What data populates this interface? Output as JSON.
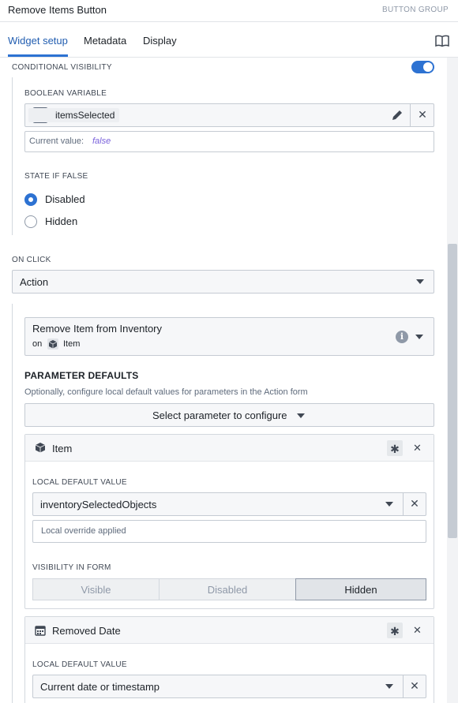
{
  "header": {
    "title": "Remove Items Button",
    "group": "BUTTON GROUP"
  },
  "tabs": [
    {
      "label": "Widget setup",
      "active": true
    },
    {
      "label": "Metadata",
      "active": false
    },
    {
      "label": "Display",
      "active": false
    }
  ],
  "conditional_visibility": {
    "label": "CONDITIONAL VISIBILITY",
    "enabled": true,
    "boolean_variable_label": "BOOLEAN VARIABLE",
    "variable_name": "itemsSelected",
    "current_value_label": "Current value:",
    "current_value": "false",
    "state_if_false_label": "STATE IF FALSE",
    "options": [
      {
        "label": "Disabled",
        "checked": true
      },
      {
        "label": "Hidden",
        "checked": false
      }
    ]
  },
  "on_click": {
    "label": "ON CLICK",
    "value": "Action"
  },
  "action": {
    "name": "Remove Item from Inventory",
    "on_label": "on",
    "object_type": "Item"
  },
  "parameter_defaults": {
    "title": "PARAMETER DEFAULTS",
    "description": "Optionally, configure local default values for parameters in the Action form",
    "select_button": "Select parameter to configure"
  },
  "params": [
    {
      "name": "Item",
      "icon": "cube-icon",
      "local_default_label": "LOCAL DEFAULT VALUE",
      "value": "inventorySelectedObjects",
      "note": "Local override applied",
      "visibility_label": "VISIBILITY IN FORM",
      "visibility_options": [
        {
          "label": "Visible",
          "active": false
        },
        {
          "label": "Disabled",
          "active": false
        },
        {
          "label": "Hidden",
          "active": true
        }
      ]
    },
    {
      "name": "Removed Date",
      "icon": "calendar-icon",
      "local_default_label": "LOCAL DEFAULT VALUE",
      "value": "Current date or timestamp"
    }
  ],
  "colors": {
    "accent": "#2d72d2",
    "text": "#1c2127",
    "muted": "#5f6b7c"
  }
}
